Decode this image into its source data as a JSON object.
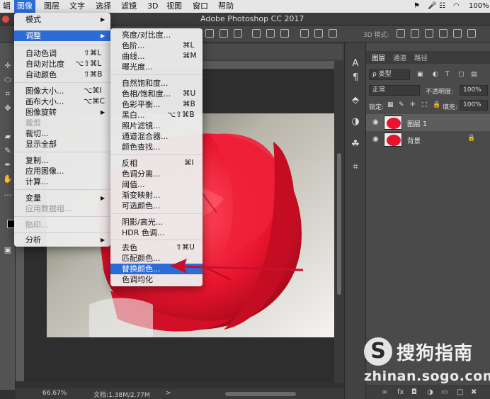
{
  "menubar": {
    "items": [
      "辑",
      "图像",
      "图层",
      "文字",
      "选择",
      "滤镜",
      "3D",
      "视图",
      "窗口",
      "帮助"
    ],
    "active": "图像",
    "battery": "100%"
  },
  "window": {
    "title": "Adobe Photoshop CC 2017"
  },
  "options_bar": {
    "mode_3d": "3D 模式:"
  },
  "status_bar": {
    "zoom": "66.67%",
    "doc": "文档:1.38M/2.77M",
    "arrow": ">"
  },
  "layers_panel": {
    "tabs": [
      "图层",
      "通道",
      "路径"
    ],
    "filter_kind": "ρ 类型",
    "blend_mode": "正常",
    "opacity_label": "不透明度:",
    "opacity_value": "100%",
    "lock_label": "锁定:",
    "fill_label": "填充:",
    "fill_value": "100%",
    "layers": [
      {
        "name": "图层 1",
        "selected": true
      },
      {
        "name": "背景",
        "locked": true
      }
    ],
    "bottom_icons": [
      "link-icon",
      "fx",
      "mask-icon",
      "adjustment-icon",
      "folder-icon",
      "new-layer-icon",
      "trash-icon"
    ],
    "fx_label": "fx"
  },
  "image_menu": {
    "items": [
      {
        "label": "模式",
        "submenu": true
      },
      {
        "label": "调整",
        "submenu": true,
        "highlighted": true
      },
      {
        "label": "自动色调",
        "shortcut": "⇧⌘L"
      },
      {
        "label": "自动对比度",
        "shortcut": "⌥⇧⌘L"
      },
      {
        "label": "自动颜色",
        "shortcut": "⇧⌘B"
      },
      {
        "label": "图像大小...",
        "shortcut": "⌥⌘I"
      },
      {
        "label": "画布大小...",
        "shortcut": "⌥⌘C"
      },
      {
        "label": "图像旋转",
        "submenu": true
      },
      {
        "label": "裁剪",
        "disabled": true
      },
      {
        "label": "裁切..."
      },
      {
        "label": "显示全部"
      },
      {
        "label": "复制..."
      },
      {
        "label": "应用图像..."
      },
      {
        "label": "计算..."
      },
      {
        "label": "变量",
        "submenu": true
      },
      {
        "label": "应用数据组...",
        "disabled": true
      },
      {
        "label": "陷印...",
        "disabled": true
      },
      {
        "label": "分析",
        "submenu": true
      }
    ]
  },
  "adjust_menu": {
    "items": [
      {
        "label": "亮度/对比度..."
      },
      {
        "label": "色阶...",
        "shortcut": "⌘L"
      },
      {
        "label": "曲线...",
        "shortcut": "⌘M"
      },
      {
        "label": "曝光度..."
      },
      {
        "label": "自然饱和度..."
      },
      {
        "label": "色相/饱和度...",
        "shortcut": "⌘U"
      },
      {
        "label": "色彩平衡...",
        "shortcut": "⌘B"
      },
      {
        "label": "黑白...",
        "shortcut": "⌥⇧⌘B"
      },
      {
        "label": "照片滤镜..."
      },
      {
        "label": "通道混合器..."
      },
      {
        "label": "颜色查找..."
      },
      {
        "label": "反相",
        "shortcut": "⌘I"
      },
      {
        "label": "色调分离..."
      },
      {
        "label": "阈值..."
      },
      {
        "label": "渐变映射..."
      },
      {
        "label": "可选颜色..."
      },
      {
        "label": "阴影/高光..."
      },
      {
        "label": "HDR 色调..."
      },
      {
        "label": "去色",
        "shortcut": "⇧⌘U"
      },
      {
        "label": "匹配颜色..."
      },
      {
        "label": "替换颜色...",
        "highlighted": true
      },
      {
        "label": "色调均化"
      }
    ]
  },
  "watermark": {
    "logo": "S",
    "title": "搜狗指南",
    "url": "zhinan.sogo.com"
  },
  "colors": {
    "menu_highlight": "#2d6bd7",
    "annotation_arrow": "#c8102e",
    "rose": "#e8142e"
  }
}
